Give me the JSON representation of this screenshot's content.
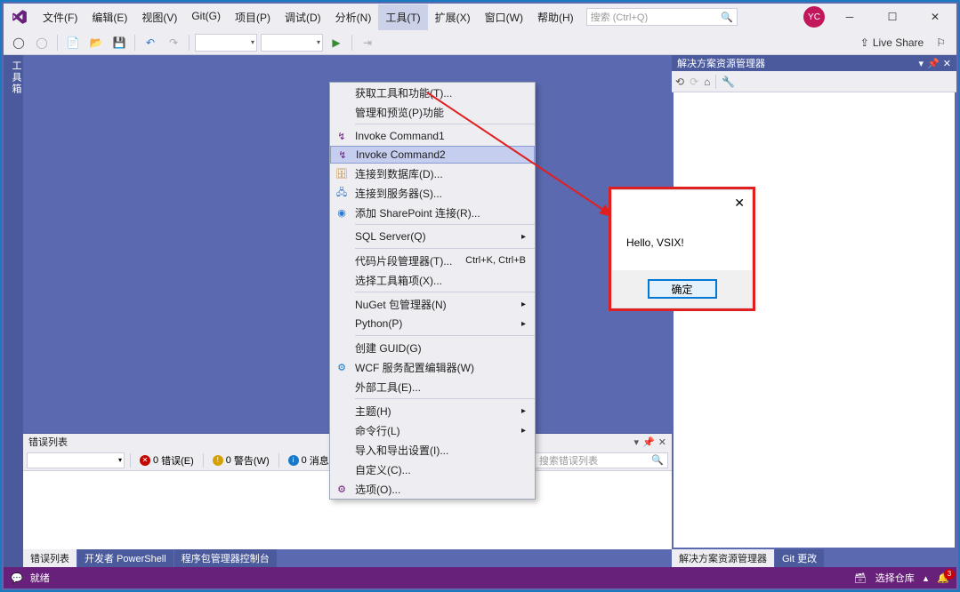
{
  "menu": {
    "file": "文件(F)",
    "edit": "编辑(E)",
    "view": "视图(V)",
    "git": "Git(G)",
    "project": "项目(P)",
    "debug": "调试(D)",
    "analyze": "分析(N)",
    "tools": "工具(T)",
    "extensions": "扩展(X)",
    "window": "窗口(W)",
    "help": "帮助(H)"
  },
  "search": {
    "placeholder": "搜索 (Ctrl+Q)"
  },
  "avatar": "YC",
  "liveshare": "Live Share",
  "sidebar": {
    "toolbox": "工具箱"
  },
  "tools_menu": {
    "getTools": "获取工具和功能(T)...",
    "managePreview": "管理和预览(P)功能",
    "invoke1": "Invoke Command1",
    "invoke2": "Invoke Command2",
    "connectDB": "连接到数据库(D)...",
    "connectSrv": "连接到服务器(S)...",
    "addSP": "添加 SharePoint 连接(R)...",
    "sql": "SQL Server(Q)",
    "snippets": "代码片段管理器(T)...",
    "snippets_sc": "Ctrl+K, Ctrl+B",
    "chooseToolbox": "选择工具箱项(X)...",
    "nuget": "NuGet 包管理器(N)",
    "python": "Python(P)",
    "createGuid": "创建 GUID(G)",
    "wcf": "WCF 服务配置编辑器(W)",
    "external": "外部工具(E)...",
    "theme": "主题(H)",
    "cmdline": "命令行(L)",
    "importExport": "导入和导出设置(I)...",
    "customize": "自定义(C)...",
    "options": "选项(O)..."
  },
  "dialog": {
    "body": "Hello, VSIX!",
    "ok": "确定",
    "close": "✕"
  },
  "solution": {
    "title": "解决方案资源管理器",
    "tab1": "解决方案资源管理器",
    "tab2": "Git 更改"
  },
  "errorlist": {
    "title": "错误列表",
    "errors": "错误(E)",
    "errors_n": "0",
    "warnings": "警告(W)",
    "warnings_n": "0",
    "messages": "消息(M)",
    "messages_n": "0",
    "search": "搜索错误列表",
    "tab1": "错误列表",
    "tab2": "开发者 PowerShell",
    "tab3": "程序包管理器控制台"
  },
  "status": {
    "ready": "就绪",
    "repo": "选择仓库",
    "notifications": "3"
  }
}
